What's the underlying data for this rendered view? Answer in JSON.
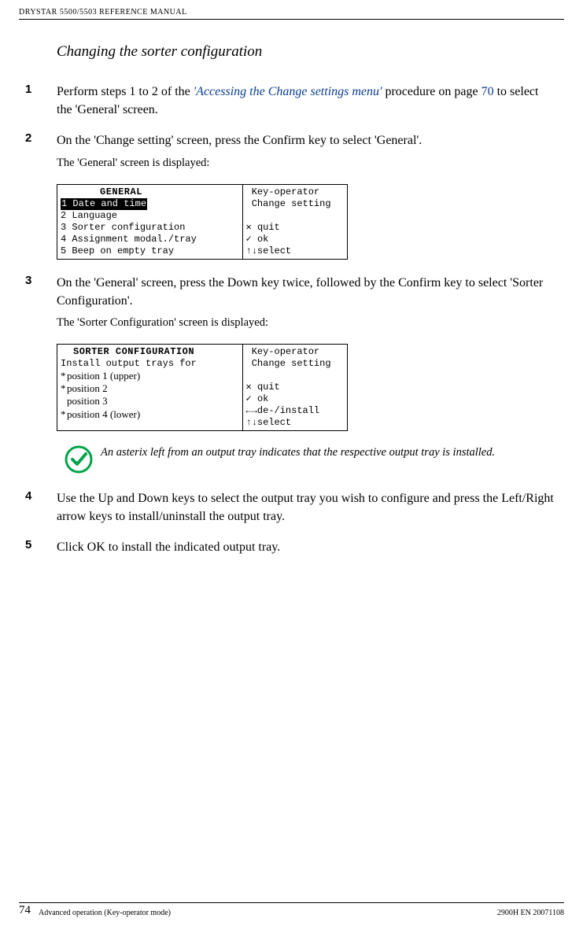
{
  "header": {
    "title": "DRYSTAR 5500/5503 REFERENCE MANUAL"
  },
  "section_title": "Changing the sorter configuration",
  "steps": {
    "s1": {
      "num": "1",
      "pre": "Perform steps 1 to 2 of the ",
      "link": "'Accessing the Change settings menu'",
      "mid": " procedure on page ",
      "pageref": "70",
      "post": " to select the 'General' screen."
    },
    "s2": {
      "num": "2",
      "text": "On the 'Change setting' screen, press the Confirm key to select 'General'.",
      "sub": "The 'General' screen is displayed:"
    },
    "s3": {
      "num": "3",
      "text": "On the 'General' screen, press the Down key twice, followed by the Confirm key to select 'Sorter Configuration'.",
      "sub": "The 'Sorter Configuration' screen is displayed:"
    },
    "s4": {
      "num": "4",
      "text": "Use the Up and Down keys to select the output tray you wish to configure and press the Left/Right arrow keys to install/uninstall the output tray."
    },
    "s5": {
      "num": "5",
      "text": "Click OK to install the indicated output tray."
    }
  },
  "lcd1": {
    "title": "GENERAL",
    "rows": [
      "1 Date and time",
      "2 Language",
      "3 Sorter configuration",
      "4 Assignment modal./tray",
      "5 Beep on empty tray"
    ],
    "right": " Key-operator\n Change setting\n\n✕ quit\n✓ ok\n↑↓select"
  },
  "lcd2": {
    "title": "SORTER CONFIGURATION",
    "instr": "Install output trays for",
    "positions": [
      {
        "star": "*",
        "label": "position 1 (upper)"
      },
      {
        "star": "*",
        "label": "position 2"
      },
      {
        "star": "",
        "label": "position 3"
      },
      {
        "star": "*",
        "label": "position 4 (lower)"
      }
    ],
    "right": " Key-operator\n Change setting\n\n✕ quit\n✓ ok\n←→de-/install\n↑↓select"
  },
  "note": {
    "text": "An asterix left from an output tray indicates that the respective output tray is installed."
  },
  "footer": {
    "page": "74",
    "left": "Advanced operation (Key-operator mode)",
    "right": "2900H EN 20071108"
  }
}
